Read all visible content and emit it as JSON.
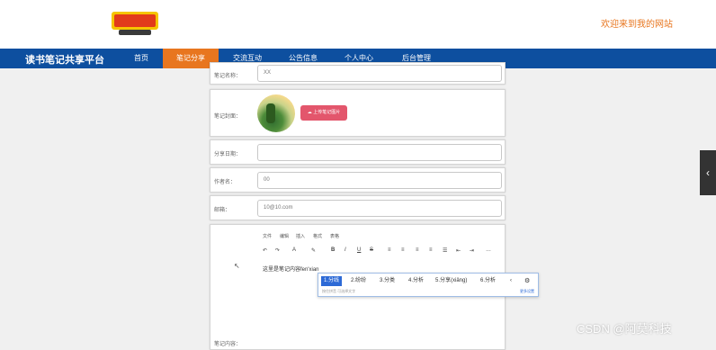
{
  "header": {
    "logo_alt": "Digimon logo",
    "welcome": "欢迎来到我的网站"
  },
  "nav": {
    "brand": "读书笔记共享平台",
    "items": [
      {
        "label": "首页"
      },
      {
        "label": "笔记分享"
      },
      {
        "label": "交流互动"
      },
      {
        "label": "公告信息"
      },
      {
        "label": "个人中心"
      },
      {
        "label": "后台管理"
      }
    ],
    "active_index": 1
  },
  "form": {
    "field1_label": "笔记名称：",
    "field1_value": "XX",
    "avatar_label": "笔记封面：",
    "upload_label": "上传笔记图片",
    "field3_label": "分享日期：",
    "field3_value": "",
    "field4_label": "作者名：",
    "field4_value": "00",
    "field5_label": "邮箱：",
    "field5_value": "10@10.com",
    "editor_label": "笔记内容：",
    "editor_menu": [
      "文件",
      "编辑",
      "插入",
      "格式",
      "表格"
    ],
    "editor_text": "这里是笔记内容fen'xian"
  },
  "ime": {
    "candidates": [
      "1.分线",
      "2.纷纷",
      "3.分类",
      "4.分析",
      "5.分享(xiǎng)",
      "6.分析"
    ],
    "hint": "按住拼音 可选择文字",
    "more": "更多设置"
  },
  "watermark": "CSDN @阿莫科技"
}
